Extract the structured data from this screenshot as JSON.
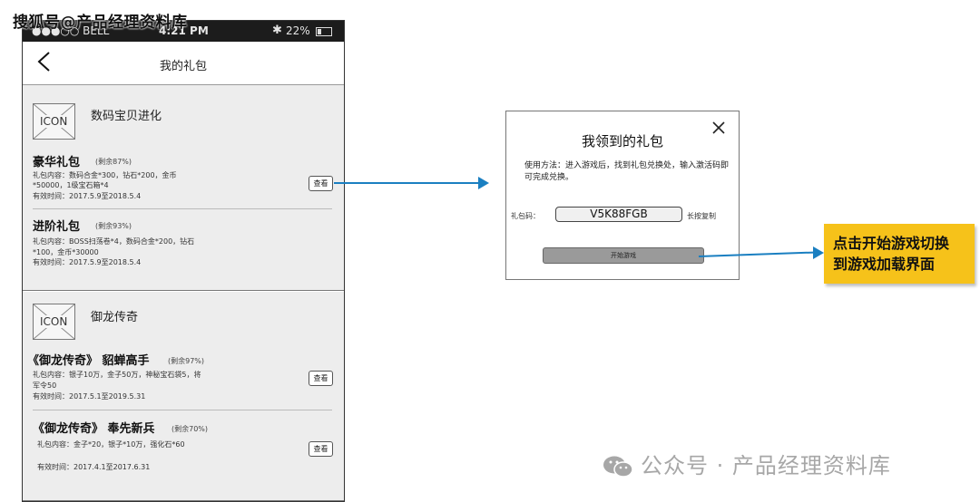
{
  "watermark_top": "搜狐号@产品经理资料库",
  "statusbar": {
    "carrier": "●●●○○ BELL",
    "time": "4:21 PM",
    "bt": "✱",
    "battery": "22%"
  },
  "nav": {
    "title": "我的礼包"
  },
  "cards": [
    {
      "icon_label": "ICON",
      "game": "数码宝贝进化",
      "packages": [
        {
          "title": "豪华礼包",
          "remain": "(剩余87%)",
          "content_lines": [
            "礼包内容：数码合金*300，钻石*200，金币",
            "*50000，1级宝石箱*4"
          ],
          "valid": "有效时间：2017.5.9至2018.5.4",
          "view": "查看"
        },
        {
          "title": "进阶礼包",
          "remain": "(剩余93%)",
          "content_lines": [
            "礼包内容：BOSS扫荡卷*4，数码合金*200，钻石",
            "*100，金币*30000"
          ],
          "valid": "有效时间：2017.5.9至2018.5.4"
        }
      ]
    },
    {
      "icon_label": "ICON",
      "game": "御龙传奇",
      "packages": [
        {
          "title": "《御龙传奇》 貂蝉高手",
          "remain": "(剩余97%)",
          "content_lines": [
            "礼包内容：银子10万，金子50万，神秘宝石袋5，将",
            "军令50"
          ],
          "valid": "有效时间：2017.5.1至2019.5.31",
          "view": "查看"
        },
        {
          "title": "《御龙传奇》 奉先新兵",
          "remain": "(剩余70%)",
          "content_lines": [
            "礼包内容：金子*20，银子*10万，强化石*60"
          ],
          "valid": "有效时间：2017.4.1至2017.6.31",
          "view": "查看"
        }
      ]
    }
  ],
  "dialog": {
    "title": "我领到的礼包",
    "usage": "使用方法：进入游戏后，找到礼包兑换处，输入激活码即可完成兑换。",
    "code_label": "礼包码：",
    "code": "V5K88FGB",
    "copy_hint": "长按复制",
    "start_button": "开始游戏"
  },
  "callout": {
    "line1": "点击开始游戏切换",
    "line2": "到游戏加载界面"
  },
  "watermark_bottom": "公众号 · 产品经理资料库",
  "colors": {
    "arrow": "#1a7fc1",
    "callout_bg": "#f6c21a",
    "statusbar_bg": "#1c1c1c",
    "card_bg": "#ededed"
  }
}
